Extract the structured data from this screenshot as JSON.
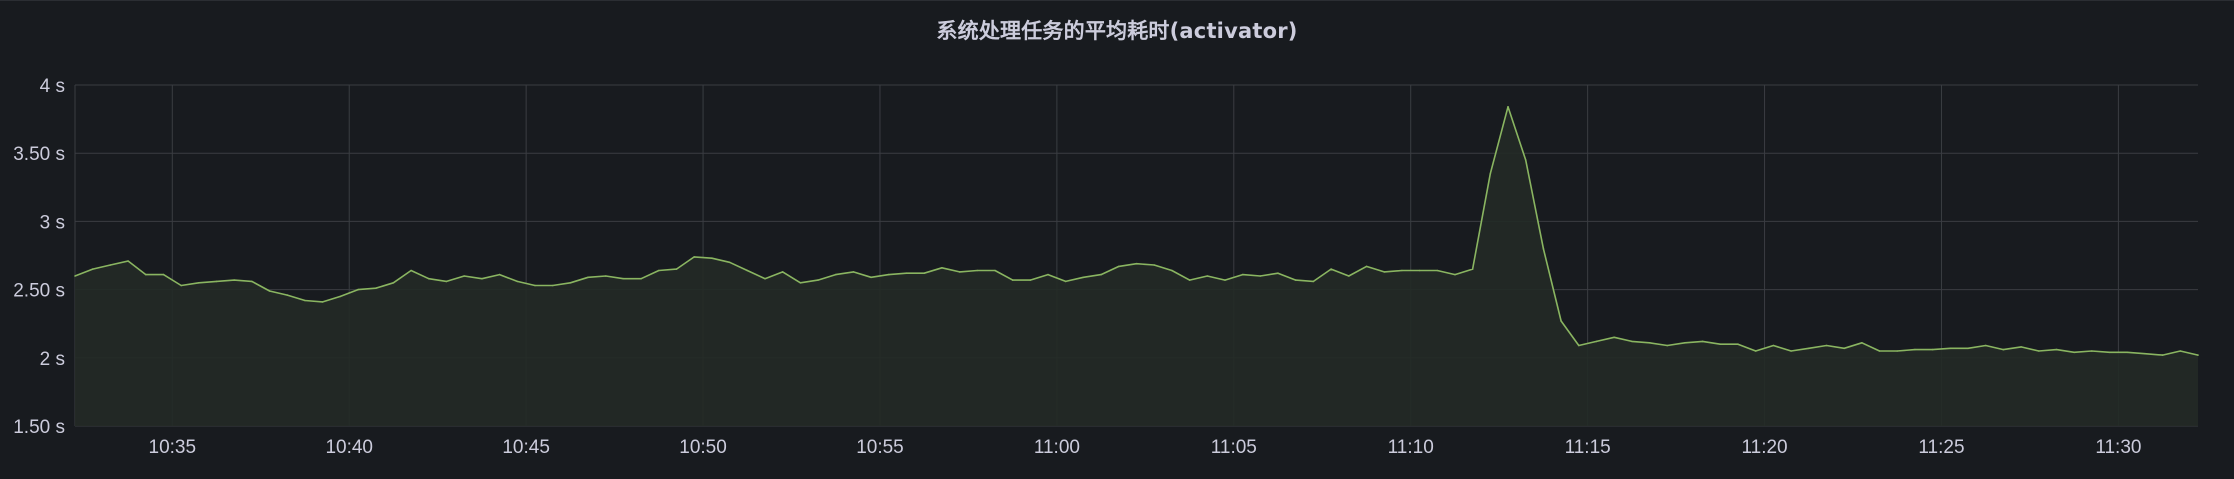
{
  "panel": {
    "title": "系统处理任务的平均耗时(activator)"
  },
  "colors": {
    "background": "#181b1f",
    "grid": "#3a3d42",
    "text": "#ccccdc",
    "series_line": "#8ab561",
    "series_fill": "#232a26"
  },
  "chart_data": {
    "type": "area",
    "title": "系统处理任务的平均耗时(activator)",
    "xlabel": "",
    "ylabel": "",
    "x_ticks": [
      "10:35",
      "10:40",
      "10:45",
      "10:50",
      "10:55",
      "11:00",
      "11:05",
      "11:10",
      "11:15",
      "11:20",
      "11:25",
      "11:30"
    ],
    "y_ticks": [
      "1.50 s",
      "2 s",
      "2.50 s",
      "3 s",
      "3.50 s",
      "4 s"
    ],
    "y_tick_values": [
      1.5,
      2,
      2.5,
      3,
      3.5,
      4
    ],
    "xlim": [
      "10:32:15",
      "11:32:15"
    ],
    "ylim": [
      1.5,
      4
    ],
    "y_unit": "s",
    "grid": true,
    "legend": "none",
    "series": [
      {
        "x": [
          "10:32:15",
          "10:32:45",
          "10:33:15",
          "10:33:45",
          "10:34:15",
          "10:34:45",
          "10:35:15",
          "10:35:45",
          "10:36:15",
          "10:36:45",
          "10:37:15",
          "10:37:45",
          "10:38:15",
          "10:38:45",
          "10:39:15",
          "10:39:45",
          "10:40:15",
          "10:40:45",
          "10:41:15",
          "10:41:45",
          "10:42:15",
          "10:42:45",
          "10:43:15",
          "10:43:45",
          "10:44:15",
          "10:44:45",
          "10:45:15",
          "10:45:45",
          "10:46:15",
          "10:46:45",
          "10:47:15",
          "10:47:45",
          "10:48:15",
          "10:48:45",
          "10:49:15",
          "10:49:45",
          "10:50:15",
          "10:50:45",
          "10:51:15",
          "10:51:45",
          "10:52:15",
          "10:52:45",
          "10:53:15",
          "10:53:45",
          "10:54:15",
          "10:54:45",
          "10:55:15",
          "10:55:45",
          "10:56:15",
          "10:56:45",
          "10:57:15",
          "10:57:45",
          "10:58:15",
          "10:58:45",
          "10:59:15",
          "10:59:45",
          "11:00:15",
          "11:00:45",
          "11:01:15",
          "11:01:45",
          "11:02:15",
          "11:02:45",
          "11:03:15",
          "11:03:45",
          "11:04:15",
          "11:04:45",
          "11:05:15",
          "11:05:45",
          "11:06:15",
          "11:06:45",
          "11:07:15",
          "11:07:45",
          "11:08:15",
          "11:08:45",
          "11:09:15",
          "11:09:45",
          "11:10:15",
          "11:10:45",
          "11:11:15",
          "11:11:45",
          "11:12:15",
          "11:12:45",
          "11:13:15",
          "11:13:45",
          "11:14:15",
          "11:14:45",
          "11:15:15",
          "11:15:45",
          "11:16:15",
          "11:16:45",
          "11:17:15",
          "11:17:45",
          "11:18:15",
          "11:18:45",
          "11:19:15",
          "11:19:45",
          "11:20:15",
          "11:20:45",
          "11:21:15",
          "11:21:45",
          "11:22:15",
          "11:22:45",
          "11:23:15",
          "11:23:45",
          "11:24:15",
          "11:24:45",
          "11:25:15",
          "11:25:45",
          "11:26:15",
          "11:26:45",
          "11:27:15",
          "11:27:45",
          "11:28:15",
          "11:28:45",
          "11:29:15",
          "11:29:45",
          "11:30:15",
          "11:30:45",
          "11:31:15",
          "11:31:45",
          "11:32:15"
        ],
        "values": [
          2.6,
          2.65,
          2.68,
          2.71,
          2.61,
          2.61,
          2.53,
          2.55,
          2.56,
          2.57,
          2.56,
          2.49,
          2.46,
          2.42,
          2.41,
          2.45,
          2.5,
          2.51,
          2.55,
          2.64,
          2.58,
          2.56,
          2.6,
          2.58,
          2.61,
          2.56,
          2.53,
          2.53,
          2.55,
          2.59,
          2.6,
          2.58,
          2.58,
          2.64,
          2.65,
          2.74,
          2.73,
          2.7,
          2.64,
          2.58,
          2.63,
          2.55,
          2.57,
          2.61,
          2.63,
          2.59,
          2.61,
          2.62,
          2.62,
          2.66,
          2.63,
          2.64,
          2.64,
          2.57,
          2.57,
          2.61,
          2.56,
          2.59,
          2.61,
          2.67,
          2.69,
          2.68,
          2.64,
          2.57,
          2.6,
          2.57,
          2.61,
          2.6,
          2.62,
          2.57,
          2.56,
          2.65,
          2.6,
          2.67,
          2.63,
          2.64,
          2.64,
          2.64,
          2.61,
          2.65,
          3.35,
          3.84,
          3.45,
          2.8,
          2.27,
          2.09,
          2.12,
          2.15,
          2.12,
          2.11,
          2.09,
          2.11,
          2.12,
          2.1,
          2.1,
          2.05,
          2.09,
          2.05,
          2.07,
          2.09,
          2.07,
          2.11,
          2.05,
          2.05,
          2.06,
          2.06,
          2.07,
          2.07,
          2.09,
          2.06,
          2.08,
          2.05,
          2.06,
          2.04,
          2.05,
          2.04,
          2.04,
          2.03,
          2.02,
          2.05,
          2.02
        ]
      }
    ]
  }
}
